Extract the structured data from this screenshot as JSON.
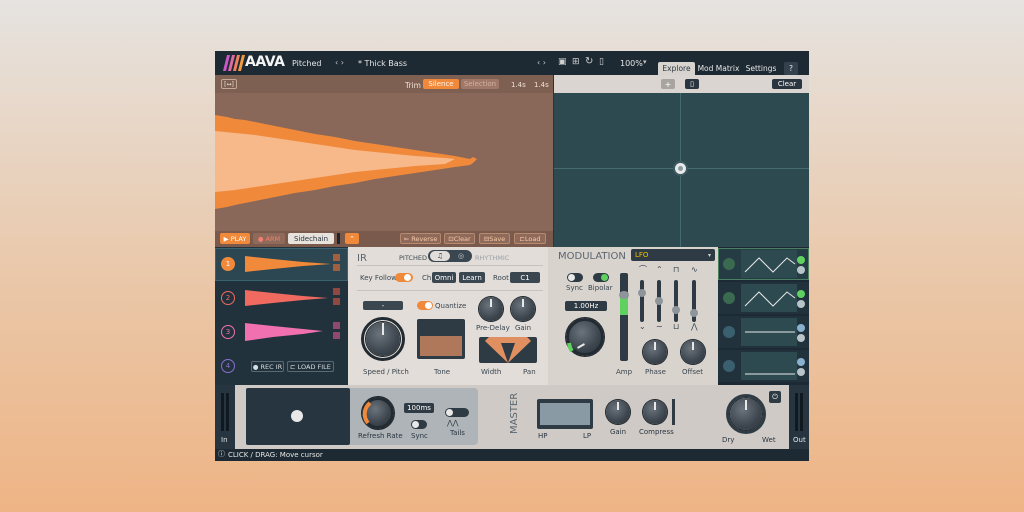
{
  "header": {
    "logo": "AAVA",
    "mode": "Pitched",
    "preset": "* Thick Bass",
    "zoom": "100%",
    "tabs": [
      "Explore",
      "Mod Matrix",
      "Settings",
      "?"
    ]
  },
  "sample_panel": {
    "fit_label": "[↔]",
    "trim_label": "Trim",
    "silence_label": "Silence",
    "selection_label": "Selection",
    "time_start": "1.4s",
    "time_end": "1.4s",
    "play_label": "PLAY",
    "arm_label": "ARM",
    "sidechain_label": "Sidechain",
    "reverse_label": "Reverse",
    "clear_label": "Clear",
    "save_label": "Save",
    "load_label": "Load"
  },
  "xy_panel": {
    "clear_label": "Clear"
  },
  "slots": [
    {
      "number": "1",
      "color": "#f08a3a"
    },
    {
      "number": "2",
      "color": "#f06a60"
    },
    {
      "number": "3",
      "color": "#f070b0"
    },
    {
      "number": "4",
      "color": "#8a70d0",
      "rec_label": "REC IR",
      "load_label": "LOAD FILE"
    }
  ],
  "ir_panel": {
    "title": "IR",
    "pitched_label": "PITCHED",
    "rhythmic_label": "RHYTHMIC",
    "key_follow_label": "Key Follow",
    "ch_label": "Ch",
    "ch_value": "Omni",
    "learn_label": "Learn",
    "root_label": "Root",
    "root_value": "C1",
    "quantize_label": "Quantize",
    "dash_value": "-",
    "speed_label": "Speed / Pitch",
    "tone_label": "Tone",
    "predelay_label": "Pre-Delay",
    "gain_label": "Gain",
    "width_label": "Width",
    "pan_label": "Pan"
  },
  "modulation": {
    "title": "MODULATION",
    "source": "LFO",
    "sync_label": "Sync",
    "bipolar_label": "Bipolar",
    "rate_value": "1.00Hz",
    "amp_label": "Amp",
    "phase_label": "Phase",
    "offset_label": "Offset",
    "slider_levels": [
      0.75,
      0.5,
      0.25,
      0.15
    ]
  },
  "master": {
    "in_label": "In",
    "out_label": "Out",
    "refresh_label": "Refresh Rate",
    "refresh_value": "100ms",
    "sync_label": "Sync",
    "tails_label": "Tails",
    "title": "MASTER",
    "hp_label": "HP",
    "lp_label": "LP",
    "gain_label": "Gain",
    "compress_label": "Compress",
    "dry_label": "Dry",
    "wet_label": "Wet"
  },
  "status": {
    "text": "CLICK / DRAG: Move cursor"
  },
  "colors": {
    "accent": "#f08a3a",
    "panel_dark": "#263540",
    "sample_bg": "#8a6a5a",
    "xy_bg": "#2c4a50",
    "ir_bg": "#e2ddd8"
  }
}
